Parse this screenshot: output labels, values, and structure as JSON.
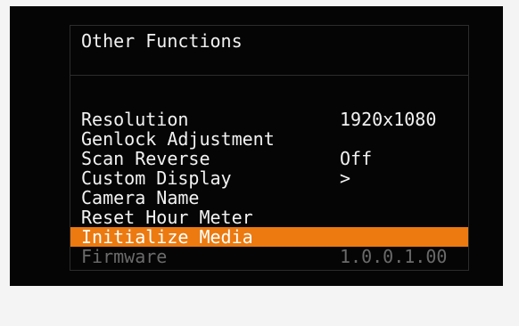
{
  "menu": {
    "title": "Other Functions",
    "items": [
      {
        "label": "Resolution",
        "value": "1920x1080"
      },
      {
        "label": "Genlock Adjustment",
        "value": ""
      },
      {
        "label": "Scan Reverse",
        "value": "Off"
      },
      {
        "label": "Custom Display",
        "value": ">"
      },
      {
        "label": "Camera Name",
        "value": ""
      },
      {
        "label": "Reset Hour Meter",
        "value": ""
      },
      {
        "label": "Initialize Media",
        "value": ""
      },
      {
        "label": "Firmware",
        "value": "1.0.0.1.00"
      }
    ],
    "selected_item": "Initialize Media",
    "disabled_item": "Firmware"
  },
  "colors": {
    "highlight": "#ec7a10",
    "text": "#f2f2f2",
    "disabled_text": "#6a6a6a",
    "background": "#050505"
  }
}
